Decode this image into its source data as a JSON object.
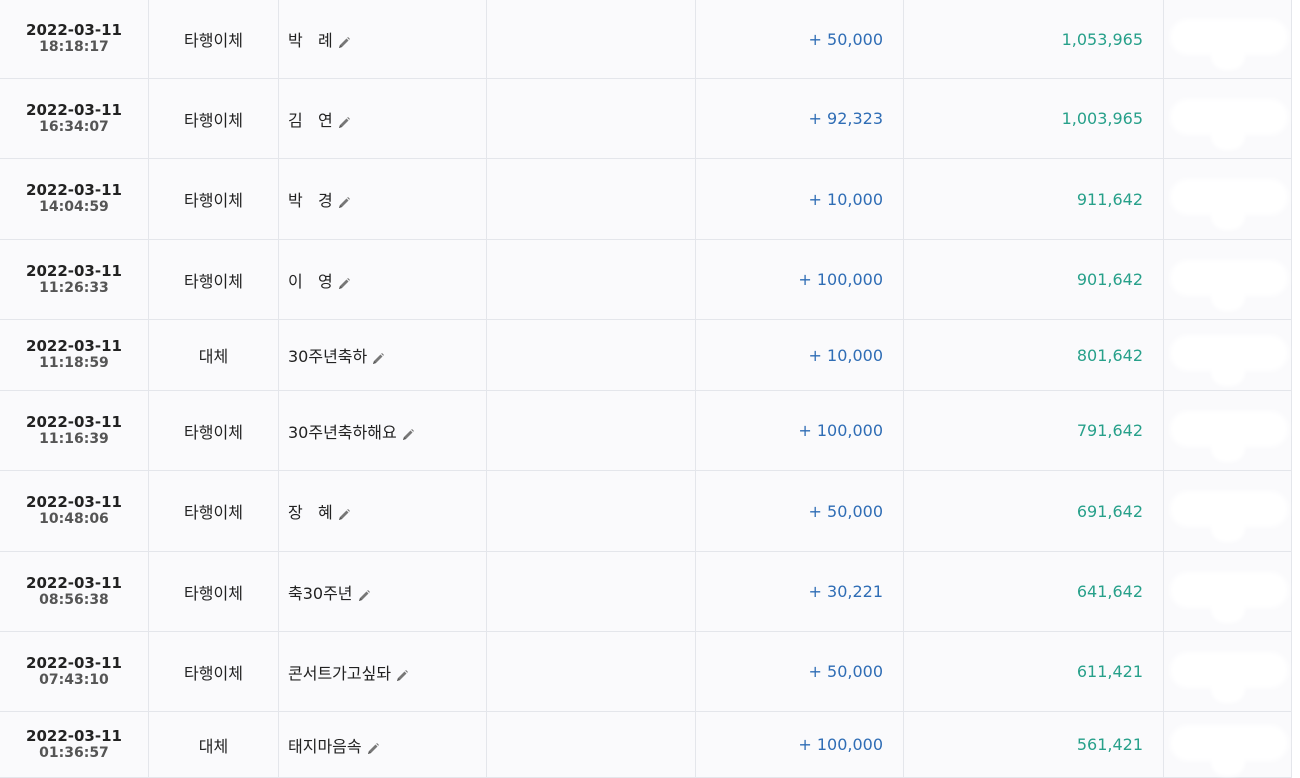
{
  "transactions": [
    {
      "date": "2022-03-11",
      "time": "18:18:17",
      "type": "타행이체",
      "memo": "박   례",
      "amount": "+ 50,000",
      "balance": "1,053,965"
    },
    {
      "date": "2022-03-11",
      "time": "16:34:07",
      "type": "타행이체",
      "memo": "김   연",
      "amount": "+ 92,323",
      "balance": "1,003,965"
    },
    {
      "date": "2022-03-11",
      "time": "14:04:59",
      "type": "타행이체",
      "memo": "박   경",
      "amount": "+ 10,000",
      "balance": "911,642"
    },
    {
      "date": "2022-03-11",
      "time": "11:26:33",
      "type": "타행이체",
      "memo": "이   영",
      "amount": "+ 100,000",
      "balance": "901,642"
    },
    {
      "date": "2022-03-11",
      "time": "11:18:59",
      "type": "대체",
      "memo": "30주년축하",
      "amount": "+ 10,000",
      "balance": "801,642"
    },
    {
      "date": "2022-03-11",
      "time": "11:16:39",
      "type": "타행이체",
      "memo": "30주년축하해요",
      "amount": "+ 100,000",
      "balance": "791,642"
    },
    {
      "date": "2022-03-11",
      "time": "10:48:06",
      "type": "타행이체",
      "memo": "장   혜",
      "amount": "+ 50,000",
      "balance": "691,642"
    },
    {
      "date": "2022-03-11",
      "time": "08:56:38",
      "type": "타행이체",
      "memo": "축30주년",
      "amount": "+ 30,221",
      "balance": "641,642"
    },
    {
      "date": "2022-03-11",
      "time": "07:43:10",
      "type": "타행이체",
      "memo": "콘서트가고싶돠",
      "amount": "+ 50,000",
      "balance": "611,421"
    },
    {
      "date": "2022-03-11",
      "time": "01:36:57",
      "type": "대체",
      "memo": "태지마음속",
      "amount": "+ 100,000",
      "balance": "561,421"
    }
  ],
  "icons": {
    "edit": "pencil-icon"
  },
  "colors": {
    "amount": "#2f6db5",
    "balance": "#27a08a"
  }
}
